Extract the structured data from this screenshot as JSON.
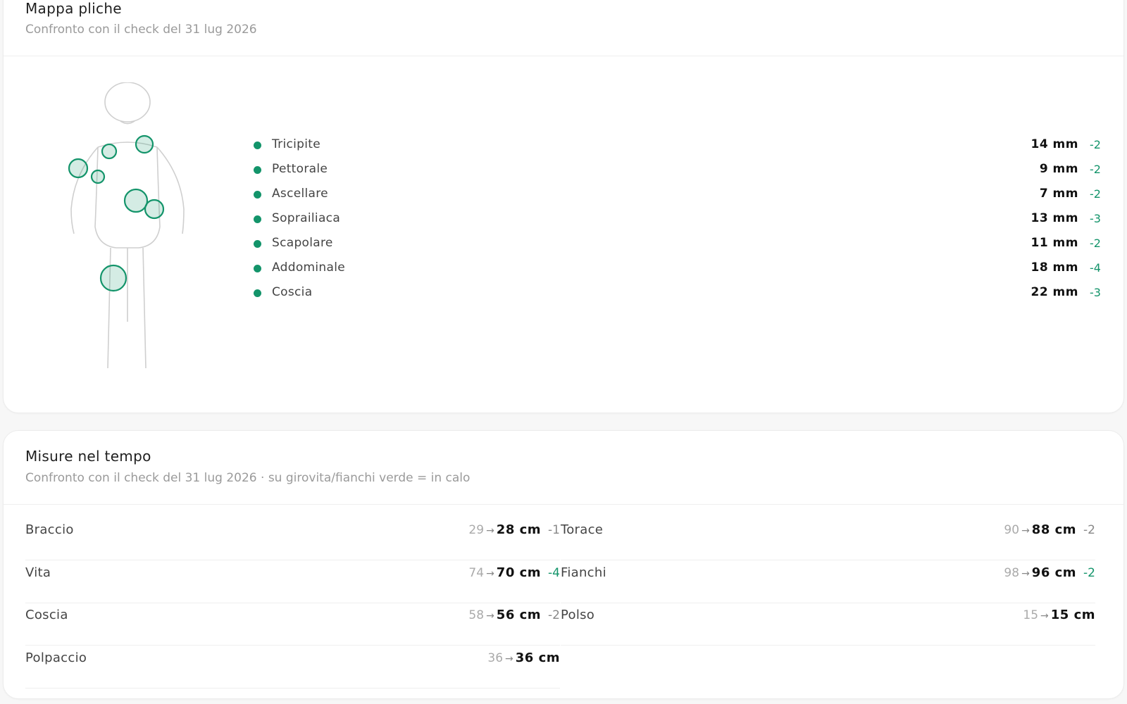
{
  "skinfold_card": {
    "title": "Mappa pliche",
    "subtitle": "Confronto con il check del 31 lug 2026",
    "accent_color": "#13946a",
    "items": [
      {
        "name": "Tricipite",
        "value": "14 mm",
        "delta": "-2"
      },
      {
        "name": "Pettorale",
        "value": "9 mm",
        "delta": "-2"
      },
      {
        "name": "Ascellare",
        "value": "7 mm",
        "delta": "-2"
      },
      {
        "name": "Soprailiaca",
        "value": "13 mm",
        "delta": "-3"
      },
      {
        "name": "Scapolare",
        "value": "11 mm",
        "delta": "-2"
      },
      {
        "name": "Addominale",
        "value": "18 mm",
        "delta": "-4"
      },
      {
        "name": "Coscia",
        "value": "22 mm",
        "delta": "-3"
      }
    ]
  },
  "measures_card": {
    "title": "Misure nel tempo",
    "subtitle": "Confronto con il check del 31 lug 2026 · su girovita/fianchi verde = in calo",
    "arrow": "→",
    "items": [
      {
        "name": "Braccio",
        "prev": "29",
        "current": "28 cm",
        "delta": "-1",
        "good": false
      },
      {
        "name": "Torace",
        "prev": "90",
        "current": "88 cm",
        "delta": "-2",
        "good": false
      },
      {
        "name": "Vita",
        "prev": "74",
        "current": "70 cm",
        "delta": "-4",
        "good": true
      },
      {
        "name": "Fianchi",
        "prev": "98",
        "current": "96 cm",
        "delta": "-2",
        "good": true
      },
      {
        "name": "Coscia",
        "prev": "58",
        "current": "56 cm",
        "delta": "-2",
        "good": false
      },
      {
        "name": "Polso",
        "prev": "15",
        "current": "15 cm",
        "delta": "",
        "good": false
      },
      {
        "name": "Polpaccio",
        "prev": "36",
        "current": "36 cm",
        "delta": "",
        "good": false
      }
    ]
  }
}
